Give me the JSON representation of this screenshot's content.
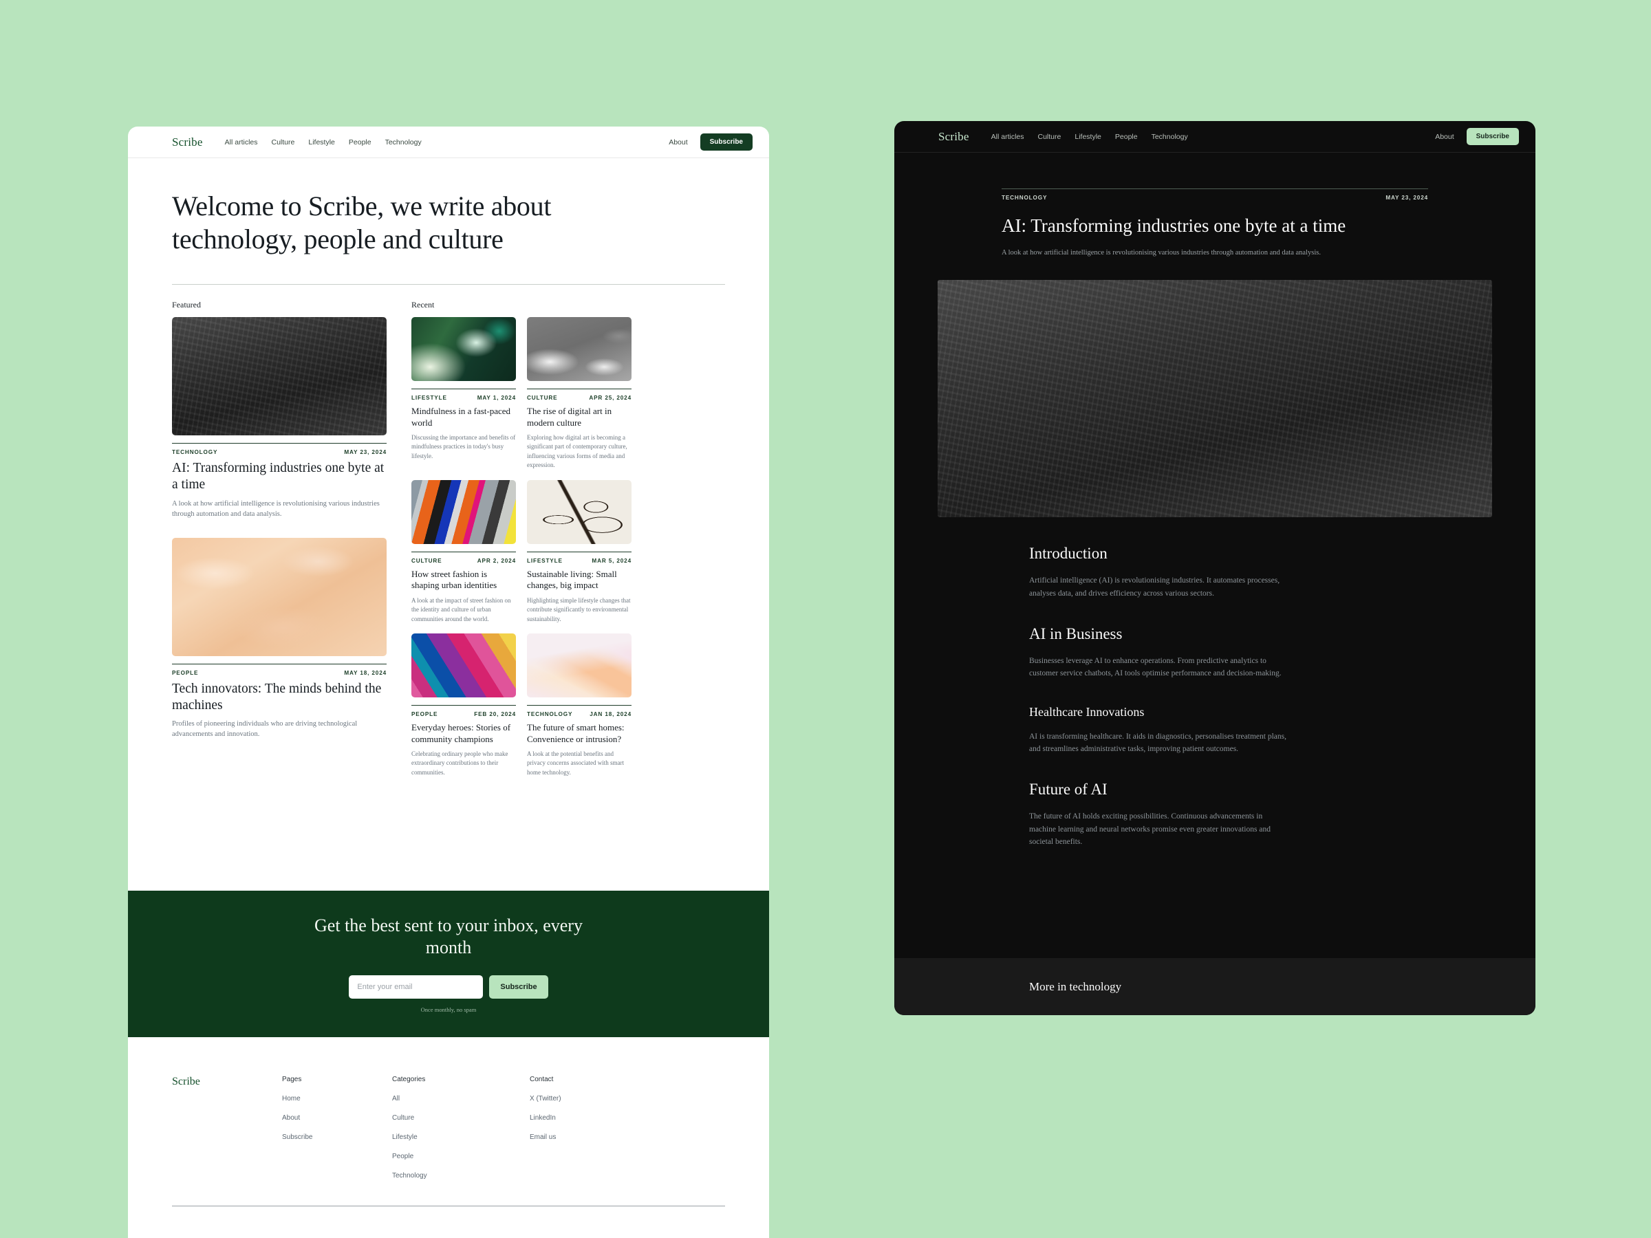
{
  "brand": "Scribe",
  "nav": {
    "links": [
      "All articles",
      "Culture",
      "Lifestyle",
      "People",
      "Technology"
    ],
    "about": "About",
    "subscribe": "Subscribe"
  },
  "hero": {
    "title": "Welcome to Scribe, we write about technology, people and culture"
  },
  "sections": {
    "featured_label": "Featured",
    "recent_label": "Recent"
  },
  "featured": [
    {
      "category": "TECHNOLOGY",
      "date": "MAY 23, 2024",
      "title": "AI: Transforming industries one byte at a time",
      "desc": "A look at how artificial intelligence is revolutionising various industries through automation and data analysis.",
      "image": "charcoal-brushstroke-texture"
    },
    {
      "category": "PEOPLE",
      "date": "MAY 18, 2024",
      "title": "Tech innovators: The minds behind the machines",
      "desc": "Profiles of pioneering individuals who are driving technological advancements and innovation.",
      "image": "peach-marble-texture"
    }
  ],
  "recent": [
    {
      "category": "LIFESTYLE",
      "date": "MAY 1, 2024",
      "title": "Mindfulness in a fast-paced world",
      "desc": "Discussing the importance and benefits of mindfulness practices in today's busy lifestyle.",
      "image": "green-blur-texture"
    },
    {
      "category": "CULTURE",
      "date": "APR 25, 2024",
      "title": "The rise of digital art in modern culture",
      "desc": "Exploring how digital art is becoming a significant part of contemporary culture, influencing various forms of media and expression.",
      "image": "grey-shadow-texture"
    },
    {
      "category": "CULTURE",
      "date": "APR 2, 2024",
      "title": "How street fashion is shaping urban identities",
      "desc": "A look at the impact of street fashion on the identity and culture of urban communities around the world.",
      "image": "colorful-fabric-texture"
    },
    {
      "category": "LIFESTYLE",
      "date": "MAR 5, 2024",
      "title": "Sustainable living: Small changes, big impact",
      "desc": "Highlighting simple lifestyle changes that contribute significantly to environmental sustainability.",
      "image": "line-drawing-texture"
    },
    {
      "category": "PEOPLE",
      "date": "FEB 20, 2024",
      "title": "Everyday heroes: Stories of community champions",
      "desc": "Celebrating ordinary people who make extraordinary contributions to their communities.",
      "image": "rainbow-gradient-texture"
    },
    {
      "category": "TECHNOLOGY",
      "date": "JAN 18, 2024",
      "title": "The future of smart homes: Convenience or intrusion?",
      "desc": "A look at the potential benefits and privacy concerns associated with smart home technology.",
      "image": "soft-peach-pink-texture"
    }
  ],
  "newsletter": {
    "heading": "Get the best sent to your inbox, every month",
    "placeholder": "Enter your email",
    "value": "",
    "button": "Subscribe",
    "note": "Once monthly, no spam"
  },
  "footer": {
    "logo": "Scribe",
    "columns": [
      {
        "heading": "Pages",
        "items": [
          "Home",
          "About",
          "Subscribe"
        ]
      },
      {
        "heading": "Categories",
        "items": [
          "All",
          "Culture",
          "Lifestyle",
          "People",
          "Technology"
        ]
      },
      {
        "heading": "Contact",
        "items": [
          "X (Twitter)",
          "LinkedIn",
          "Email us"
        ]
      }
    ]
  },
  "article": {
    "category": "TECHNOLOGY",
    "date": "MAY 23, 2024",
    "title": "AI: Transforming industries one byte at a time",
    "subtitle": "A look at how artificial intelligence is revolutionising various industries through automation and data analysis.",
    "hero_image": "charcoal-brushstroke-texture",
    "sections": [
      {
        "heading": "Introduction",
        "level": "h2",
        "body": "Artificial intelligence (AI) is revolutionising industries. It automates processes, analyses data, and drives efficiency across various sectors."
      },
      {
        "heading": "AI in Business",
        "level": "h2",
        "body": "Businesses leverage AI to enhance operations. From predictive analytics to customer service chatbots, AI tools optimise performance and decision-making."
      },
      {
        "heading": "Healthcare Innovations",
        "level": "h3",
        "body": "AI is transforming healthcare. It aids in diagnostics, personalises treatment plans, and streamlines administrative tasks, improving patient outcomes."
      },
      {
        "heading": "Future of AI",
        "level": "h2",
        "body": "The future of AI holds exciting possibilities. Continuous advancements in machine learning and neural networks promise even greater innovations and societal benefits."
      }
    ],
    "more_label": "More in technology"
  },
  "colors": {
    "page_background": "#b8e4bd",
    "brand_green": "#14502b",
    "newsletter_bg": "#0e3a1c",
    "dark_panel_bg": "#0d0d0d",
    "accent_mint": "#b8e4bd"
  }
}
